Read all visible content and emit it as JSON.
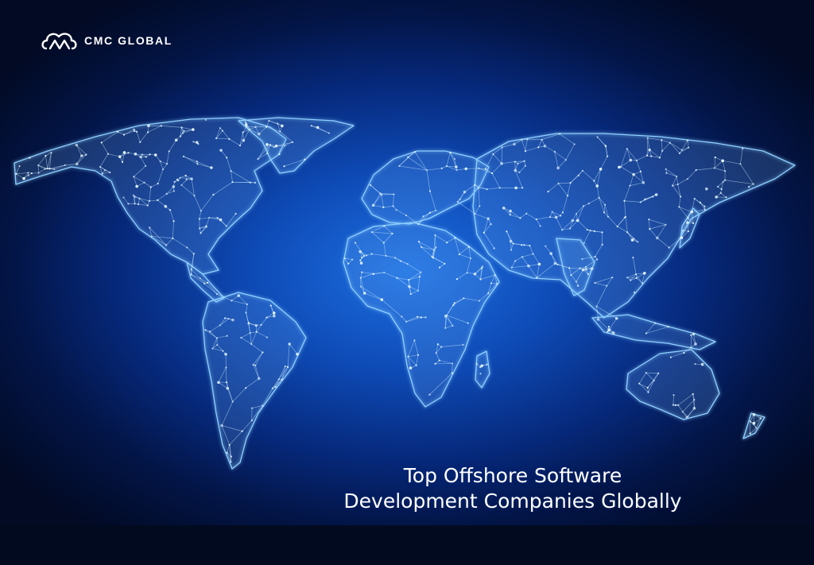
{
  "brand": {
    "name": "CMC GLOBAL",
    "logo_icon": "cmc-cloud-logo-icon"
  },
  "headline": {
    "line1": "Top Offshore Software",
    "line2": "Development Companies Globally"
  },
  "colors": {
    "background_center": "#1d6fe0",
    "background_edge": "#020a24",
    "network_line": "#9fd8ff",
    "node_glow": "#e6f7ff",
    "text": "#ffffff"
  }
}
